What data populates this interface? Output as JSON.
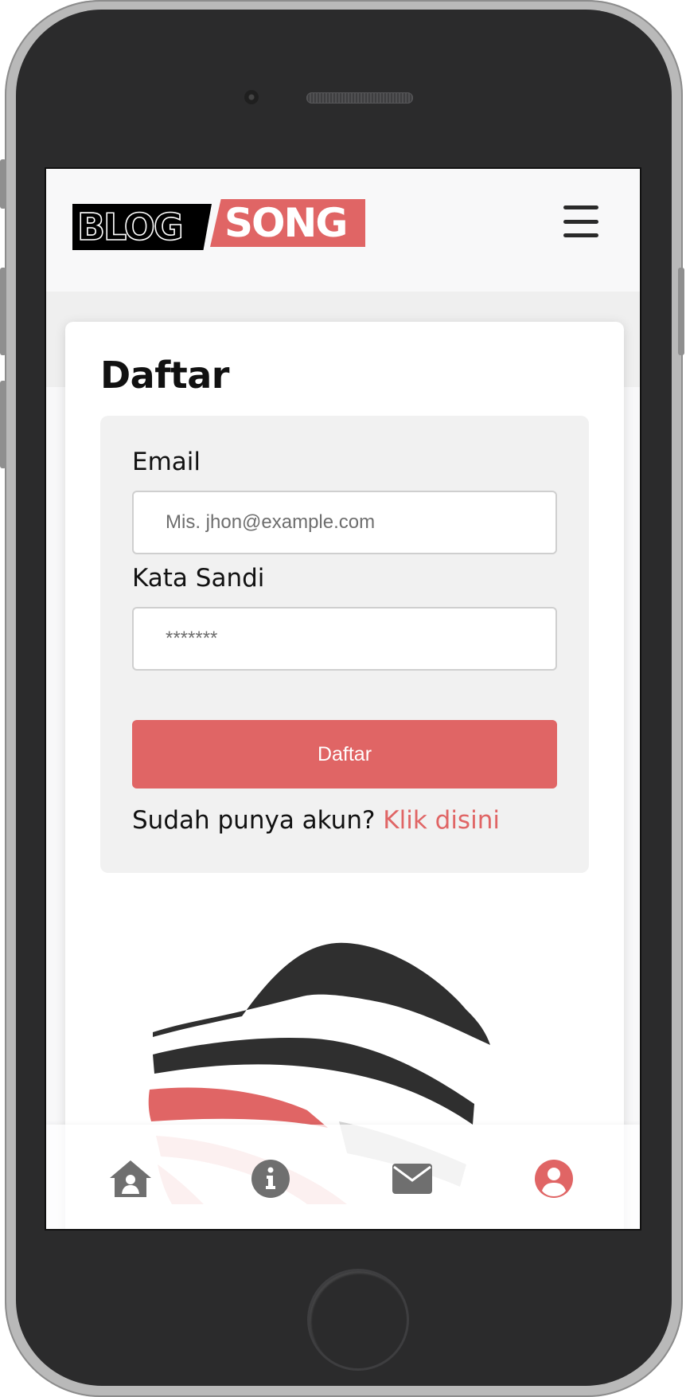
{
  "app": {
    "logo": {
      "left_text": "BLOG",
      "right_text": "SONG"
    },
    "menu_icon": "hamburger-menu-icon"
  },
  "page": {
    "title": "Daftar"
  },
  "form": {
    "email": {
      "label": "Email",
      "placeholder": "Mis. jhon@example.com",
      "value": ""
    },
    "password": {
      "label": "Kata Sandi",
      "placeholder": "*******",
      "value": ""
    },
    "submit_label": "Daftar",
    "login_prompt": "Sudah punya akun?",
    "login_link": "Klik disini"
  },
  "bottom_nav": {
    "items": [
      {
        "icon": "home-user-icon",
        "active": false
      },
      {
        "icon": "info-icon",
        "active": false
      },
      {
        "icon": "envelope-icon",
        "active": false
      },
      {
        "icon": "user-circle-icon",
        "active": true
      }
    ]
  },
  "colors": {
    "accent": "#e06565",
    "icon_inactive": "#6f6f6f",
    "text": "#111111",
    "frame": "#2b2b2c"
  }
}
